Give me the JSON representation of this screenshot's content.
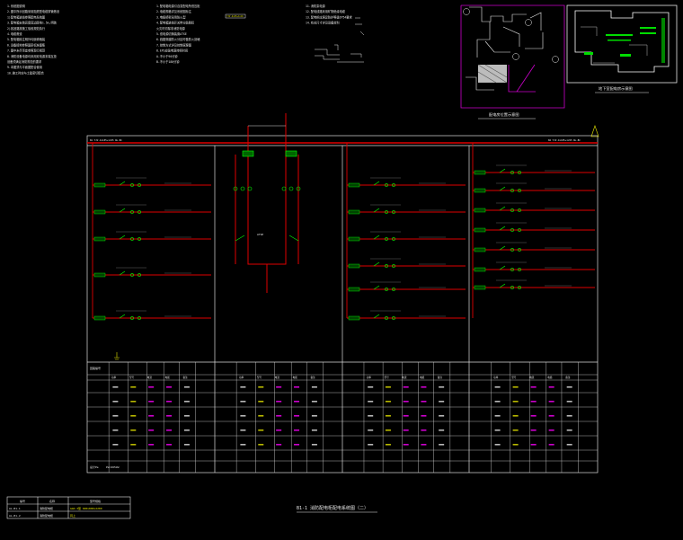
{
  "notes": {
    "col1": [
      "1.系统图说明",
      "2.图中所示回路采用阻燃型电缆穿管敷设",
      "  1)配电箱进线参照配电系统图",
      "3.配电箱安装高度底边距地1.5m,明装",
      "  2)各回路按施工验收规范执行",
      "4.电缆敷设",
      "5.配电箱除注明外均嵌墙暗装",
      "6.设备接地参照国家标准图集",
      "7.图中未尽事宜参照现行规范",
      "8.消防设备电源均采用双电源末端互投",
      "  设备须满足消防规范的要求",
      "9.本图须与平面图配合使用",
      "10.施工时应与土建密切配合"
    ],
    "col2": [
      "1.配电箱电源引自变配电所低压柜",
      "2.电缆规格详见系统图标注",
      "3.电缆桥架采用防火型",
      "4.配电箱进线开关带分励脱扣",
      "  火灾时切除非消防电源",
      "5.双电源切换装置ATSE",
      "6.线路穿越防火分区时做防火封堵",
      "7.控制方式详见控制原理图",
      "8.EPS应急电源持续时间",
      "  A-不小于90分钟",
      "  B-不小于180分钟"
    ],
    "col3": [
      "11.消防泵电源",
      "12.配电线路采用矿物绝缘电缆",
      "13.配电柜应满足防护等级IP54要求",
      "14.有关尺寸详见设备资料"
    ],
    "tag2": "YJV-4x25+1x16"
  },
  "site_plan": {
    "caption": "配电房位置示意图",
    "markers": [
      "A",
      "B",
      "C",
      "D"
    ]
  },
  "basement_plan": {
    "caption": "地下室配电房示意图"
  },
  "system": {
    "incoming_left": "N1   YJV-4x185+1x95   WL-BC",
    "incoming_right": "N2   YJV-4x185+1x95 WL-BC",
    "ats_label": "ATSE"
  },
  "table": {
    "header_left": "回路编号",
    "col_headers": [
      "功率",
      "型号",
      "电流",
      "电缆",
      "备注"
    ],
    "bottom_left": "总计Pe",
    "bottom_value": "Pe=265kW"
  },
  "title_block": {
    "title": "B1-1 消防配电柜配电系统图（二）",
    "header": [
      "编号",
      "名称",
      "型号规格"
    ],
    "rows": [
      [
        "AL-B1-1",
        "消防配电柜",
        "GGD-3型 600x800x2200"
      ],
      [
        "AL-B1-2",
        "消防配电柜",
        "同上"
      ]
    ]
  },
  "colors": {
    "bg": "#000000",
    "white": "#ffffff",
    "red": "#e00000",
    "green": "#00ff00",
    "yellow": "#ffff00",
    "magenta": "#ff00ff",
    "cyan": "#00ffff"
  }
}
